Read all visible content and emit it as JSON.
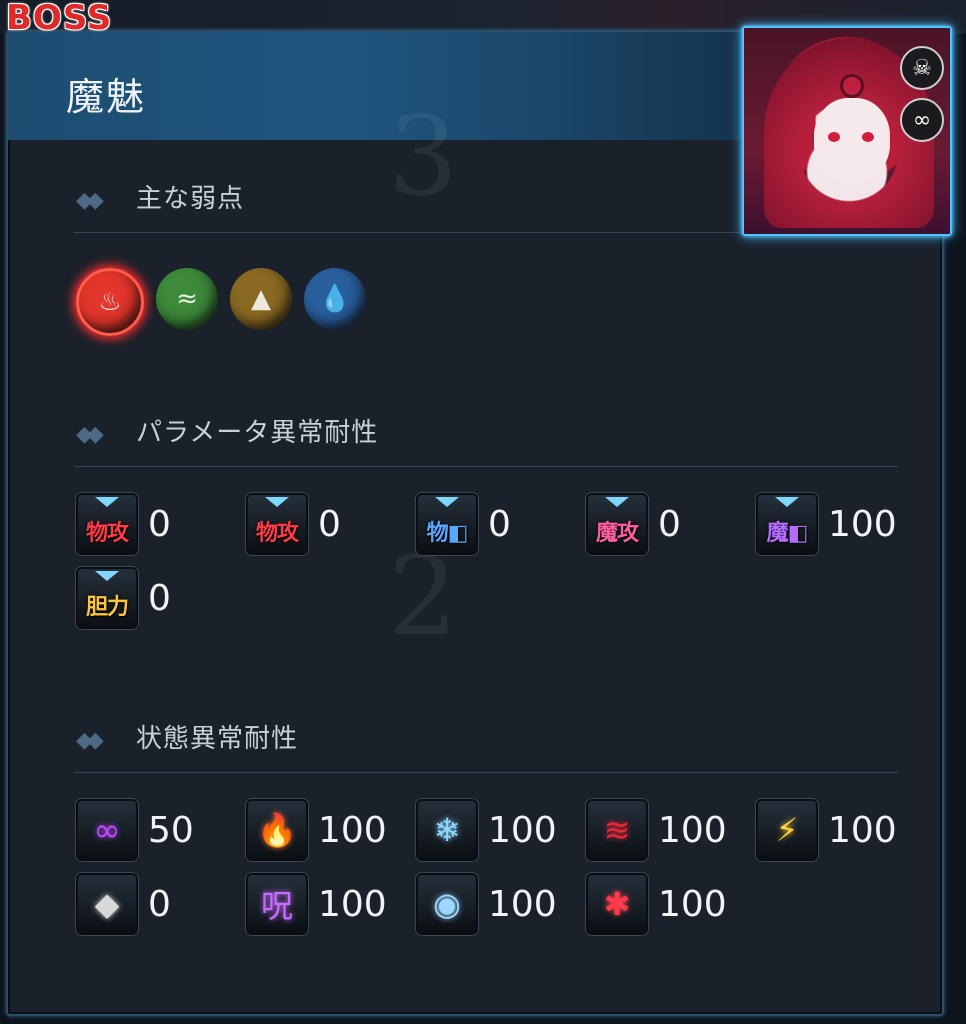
{
  "boss_tag": "BOSS",
  "enemy_name": "魔魅",
  "sections": {
    "weakness": "主な弱点",
    "param_resist": "パラメータ異常耐性",
    "status_resist": "状態異常耐性"
  },
  "weaknesses": [
    {
      "name": "fire",
      "icon": "fire-orb-icon",
      "color": "#e2352b",
      "active": true
    },
    {
      "name": "wind",
      "icon": "wind-orb-icon",
      "color": "#3c8a3a",
      "active": false
    },
    {
      "name": "earth",
      "icon": "earth-orb-icon",
      "color": "#8a6a22",
      "active": false
    },
    {
      "name": "water",
      "icon": "water-orb-icon",
      "color": "#2a5f9e",
      "active": false
    }
  ],
  "param_resist": [
    {
      "label": "物攻",
      "label_color": "#ff3b4a",
      "value": "0"
    },
    {
      "label": "物攻",
      "label_color": "#ff3b4a",
      "value": "0"
    },
    {
      "label": "物",
      "label_color": "#59a8ff",
      "shield": true,
      "value": "0"
    },
    {
      "label": "魔攻",
      "label_color": "#ff5fa0",
      "value": "0"
    },
    {
      "label": "魔",
      "label_color": "#b46cff",
      "shield": true,
      "value": "100"
    },
    {
      "label": "胆力",
      "label_color": "#ffc53a",
      "value": "0"
    }
  ],
  "status_resist": [
    {
      "icon": "rings-icon",
      "glyph": "∞",
      "color": "#c04bff",
      "value": "50"
    },
    {
      "icon": "burn-icon",
      "glyph": "🔥",
      "color": "#ff6a2e",
      "value": "100"
    },
    {
      "icon": "freeze-icon",
      "glyph": "❄",
      "color": "#8fd8ff",
      "value": "100"
    },
    {
      "icon": "bleed-icon",
      "glyph": "≋",
      "color": "#e8283a",
      "value": "100"
    },
    {
      "icon": "lightning-icon",
      "glyph": "⚡",
      "color": "#ffd43a",
      "value": "100"
    },
    {
      "icon": "petrify-icon",
      "glyph": "◆",
      "color": "#d8d8d8",
      "value": "0"
    },
    {
      "icon": "curse-icon",
      "glyph": "呪",
      "color": "#c86bff",
      "value": "100"
    },
    {
      "icon": "eye-icon",
      "glyph": "◉",
      "color": "#9fd8ff",
      "value": "100"
    },
    {
      "icon": "panic-icon",
      "glyph": "✱",
      "color": "#ff3a4a",
      "value": "100"
    }
  ]
}
